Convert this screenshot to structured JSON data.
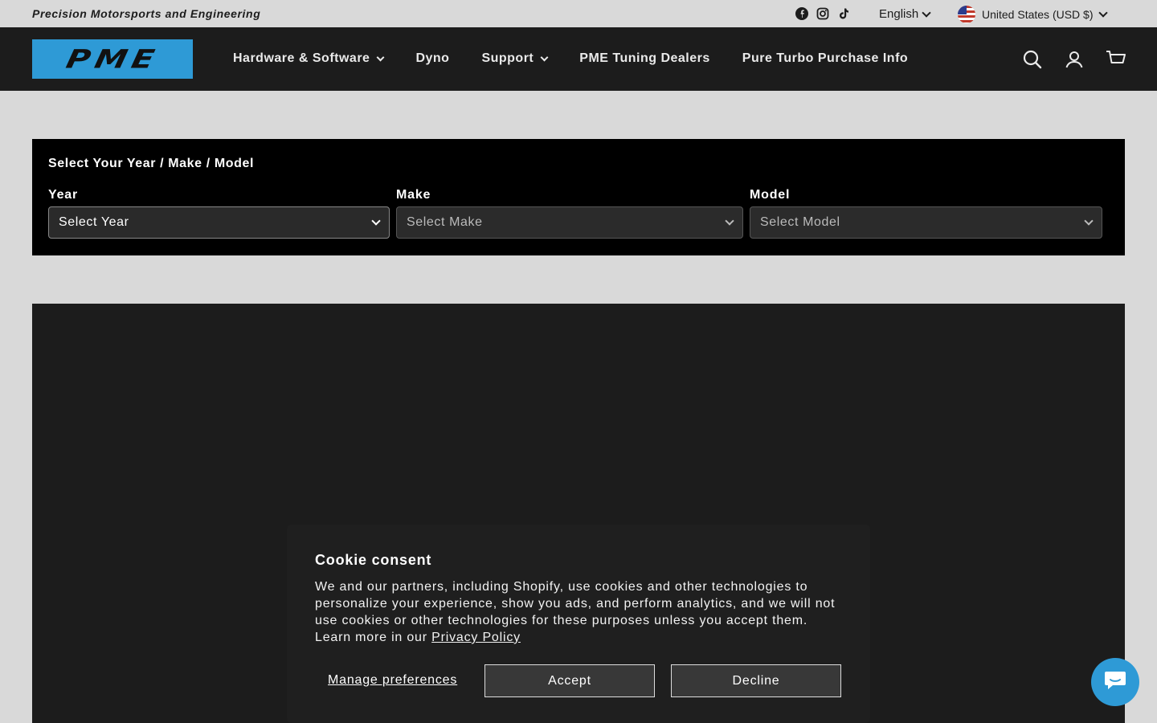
{
  "topbar": {
    "tagline": "Precision Motorsports and Engineering",
    "social": [
      "facebook-icon",
      "instagram-icon",
      "tiktok-icon"
    ],
    "language": "English",
    "country": "United States (USD $)"
  },
  "header": {
    "logo_text": "PME",
    "nav": [
      {
        "label": "Hardware & Software",
        "dropdown": true
      },
      {
        "label": "Dyno",
        "dropdown": false
      },
      {
        "label": "Support",
        "dropdown": true
      },
      {
        "label": "PME Tuning Dealers",
        "dropdown": false
      },
      {
        "label": "Pure Turbo Purchase Info",
        "dropdown": false
      }
    ],
    "icons": [
      "search-icon",
      "account-icon",
      "cart-icon"
    ]
  },
  "ymm": {
    "title": "Select Your Year / Make / Model",
    "year": {
      "label": "Year",
      "value": "Select Year"
    },
    "make": {
      "label": "Make",
      "value": "Select Make"
    },
    "model": {
      "label": "Model",
      "value": "Select Model"
    }
  },
  "cookie": {
    "title": "Cookie consent",
    "body": "We and our partners, including Shopify, use cookies and other technologies to personalize your experience, show you ads, and perform analytics, and we will not use cookies or other technologies for these purposes unless you accept them. Learn more in our ",
    "link": "Privacy Policy",
    "manage": "Manage preferences",
    "accept": "Accept",
    "decline": "Decline"
  },
  "colors": {
    "brand": "#2e9ad6",
    "header_bg": "#1c1c1c",
    "page_bg": "#d9d9d9"
  }
}
